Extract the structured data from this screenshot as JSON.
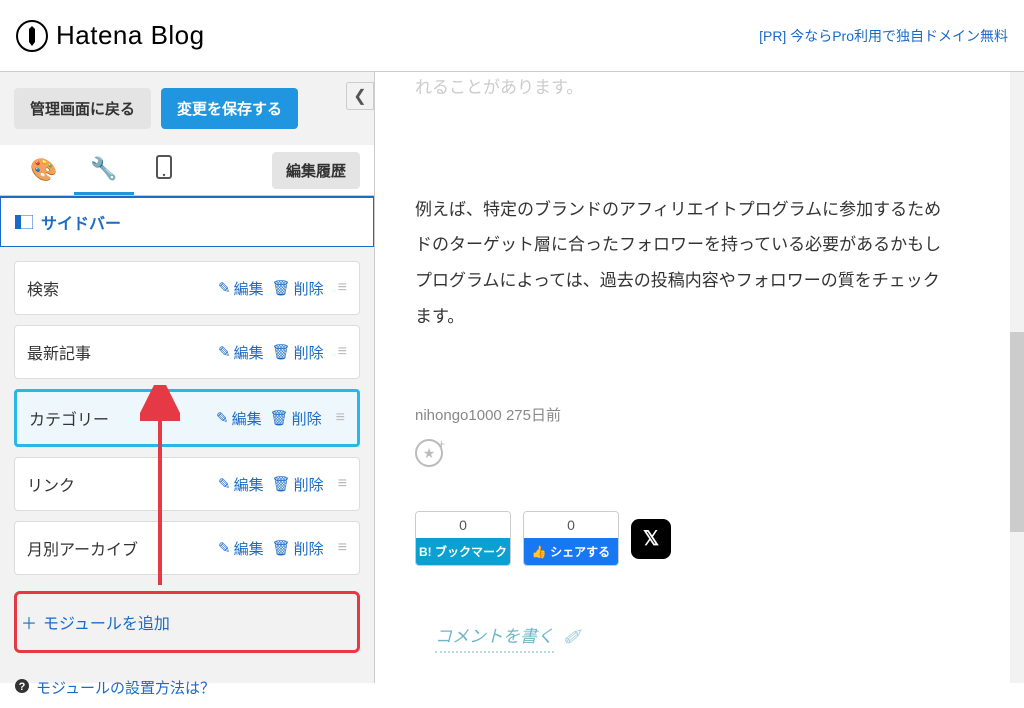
{
  "header": {
    "logo_text": "Hatena Blog",
    "pr_link": "[PR] 今ならPro利用で独自ドメイン無料"
  },
  "sidebar": {
    "back_button": "管理画面に戻る",
    "save_button": "変更を保存する",
    "history_button": "編集履歴",
    "section_title": "サイドバー",
    "modules": [
      {
        "name": "検索",
        "edit": "編集",
        "delete": "削除"
      },
      {
        "name": "最新記事",
        "edit": "編集",
        "delete": "削除"
      },
      {
        "name": "カテゴリー",
        "edit": "編集",
        "delete": "削除"
      },
      {
        "name": "リンク",
        "edit": "編集",
        "delete": "削除"
      },
      {
        "name": "月別アーカイブ",
        "edit": "編集",
        "delete": "削除"
      }
    ],
    "add_module": "モジュールを追加",
    "help_link": "モジュールの設置方法は？"
  },
  "content": {
    "faded_line": "れることがあります。",
    "paragraph_l1": "例えば、特定のブランドのアフィリエイトプログラムに参加するため",
    "paragraph_l2": "ドのターゲット層に合ったフォロワーを持っている必要があるかもし",
    "paragraph_l3": "プログラムによっては、過去の投稿内容やフォロワーの質をチェック",
    "paragraph_l4": "ます。",
    "meta_author": "nihongo1000",
    "meta_age": "275日前",
    "bookmark_count": "0",
    "bookmark_label": "B! ブックマーク",
    "share_count": "0",
    "share_label": "シェアする",
    "x_label": "𝕏",
    "comment_prompt": "コメントを書く"
  }
}
